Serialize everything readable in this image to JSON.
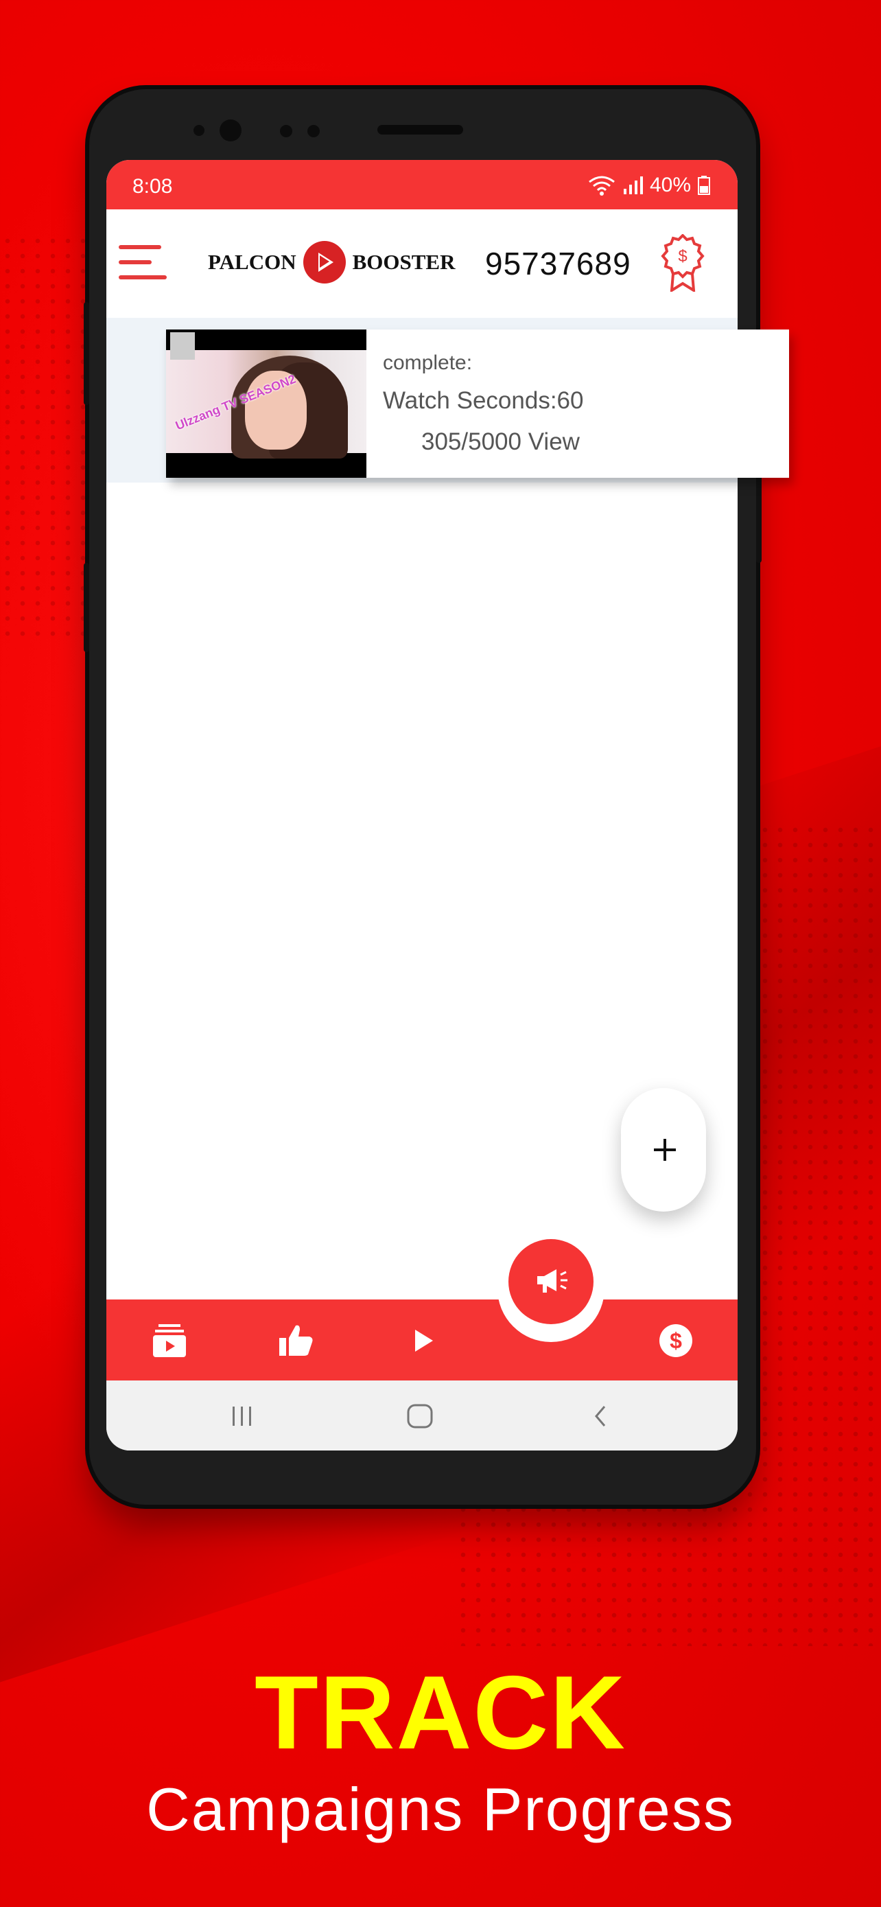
{
  "status_bar": {
    "time": "8:08",
    "battery": "40%"
  },
  "app_bar": {
    "logo_left": "PALCON",
    "logo_right": "BOOSTER",
    "coins": "95737689"
  },
  "campaign": {
    "status": "complete:",
    "watch_seconds": "Watch Seconds:60",
    "views": "305/5000 View",
    "thumbnail_caption": "Ulzzang TV SEASON2"
  },
  "bottom_nav": {
    "items": [
      "playlist-icon",
      "thumbs-up-icon",
      "play-icon",
      "megaphone-icon",
      "dollar-icon"
    ]
  },
  "promo": {
    "headline": "TRACK",
    "subline": "Campaigns Progress"
  },
  "colors": {
    "brand_red": "#f53434",
    "headline_yellow": "#ffff00"
  }
}
